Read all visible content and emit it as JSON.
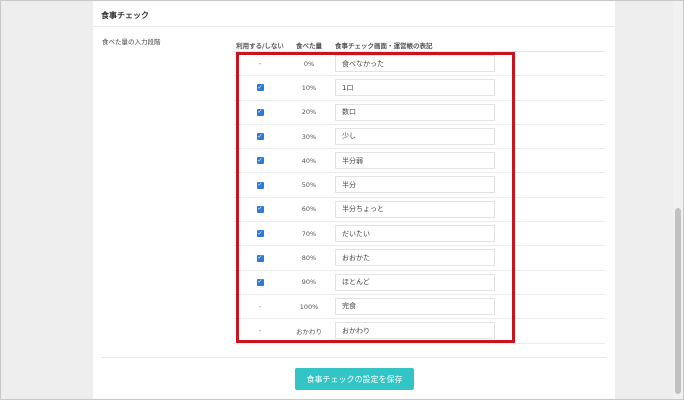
{
  "section": {
    "title": "食事チェック",
    "row_label": "食べた量の入力段階"
  },
  "table": {
    "headers": {
      "use": "利用する/しない",
      "amount": "食べた量",
      "note": "食事チェック画面・運営帳の表記"
    },
    "rows": [
      {
        "use": "-",
        "checked": false,
        "amount": "0%",
        "note": "食べなかった"
      },
      {
        "use": "checked",
        "checked": true,
        "amount": "10%",
        "note": "1口"
      },
      {
        "use": "checked",
        "checked": true,
        "amount": "20%",
        "note": "数口"
      },
      {
        "use": "checked",
        "checked": true,
        "amount": "30%",
        "note": "少し"
      },
      {
        "use": "checked",
        "checked": true,
        "amount": "40%",
        "note": "半分弱"
      },
      {
        "use": "checked",
        "checked": true,
        "amount": "50%",
        "note": "半分"
      },
      {
        "use": "checked",
        "checked": true,
        "amount": "60%",
        "note": "半分ちょっと"
      },
      {
        "use": "checked",
        "checked": true,
        "amount": "70%",
        "note": "だいたい"
      },
      {
        "use": "checked",
        "checked": true,
        "amount": "80%",
        "note": "おおかた"
      },
      {
        "use": "checked",
        "checked": true,
        "amount": "90%",
        "note": "ほとんど"
      },
      {
        "use": "-",
        "checked": false,
        "amount": "100%",
        "note": "完食"
      },
      {
        "use": "-",
        "checked": false,
        "amount": "おかわり",
        "note": "おかわり"
      }
    ]
  },
  "save_button": {
    "label": "食事チェックの設定を保存"
  },
  "colors": {
    "accent": "#33c5c5",
    "checkbox": "#2d7bd6",
    "highlight": "#c4161c"
  }
}
